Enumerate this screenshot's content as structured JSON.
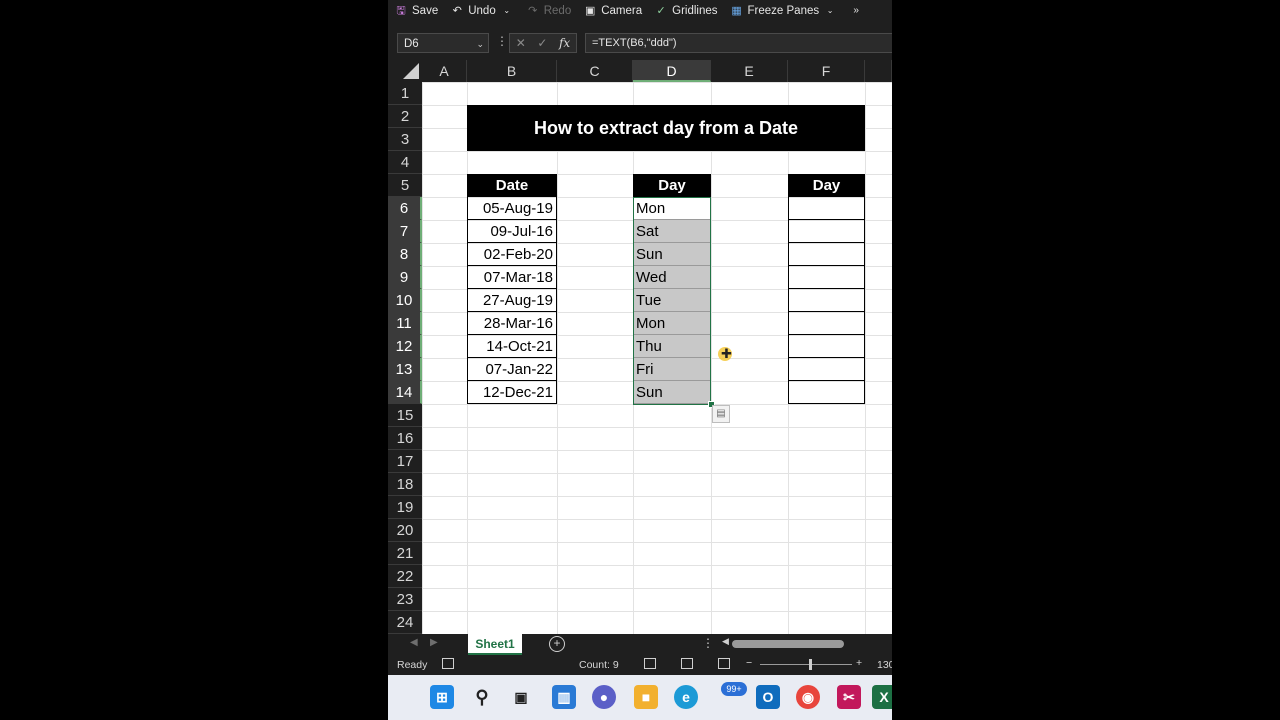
{
  "toolbar": {
    "save": "Save",
    "undo": "Undo",
    "redo": "Redo",
    "camera": "Camera",
    "gridlines": "Gridlines",
    "freeze_panes": "Freeze Panes"
  },
  "formula_bar": {
    "name_box": "D6",
    "formula": "=TEXT(B6,\"ddd\")"
  },
  "columns": [
    "A",
    "B",
    "C",
    "D",
    "E",
    "F"
  ],
  "rows": [
    "1",
    "2",
    "3",
    "4",
    "5",
    "6",
    "7",
    "8",
    "9",
    "10",
    "11",
    "12",
    "13",
    "14",
    "15",
    "16",
    "17",
    "18",
    "19",
    "20",
    "21",
    "22",
    "23",
    "24"
  ],
  "sheet": {
    "title": "How to extract day from a Date",
    "date_header": "Date",
    "day_header": "Day",
    "day_header_2": "Day",
    "dates": [
      "05-Aug-19",
      "09-Jul-16",
      "02-Feb-20",
      "07-Mar-18",
      "27-Aug-19",
      "28-Mar-16",
      "14-Oct-21",
      "07-Jan-22",
      "12-Dec-21"
    ],
    "days": [
      "Mon",
      "Sat",
      "Sun",
      "Wed",
      "Tue",
      "Mon",
      "Thu",
      "Fri",
      "Sun"
    ]
  },
  "tabs": {
    "sheet1": "Sheet1"
  },
  "status": {
    "ready": "Ready",
    "count": "Count: 9",
    "zoom": "130"
  },
  "taskbar": {
    "badge": "99+"
  },
  "colors": {
    "accent": "#217346",
    "selection_fill": "#c8c8c8"
  }
}
